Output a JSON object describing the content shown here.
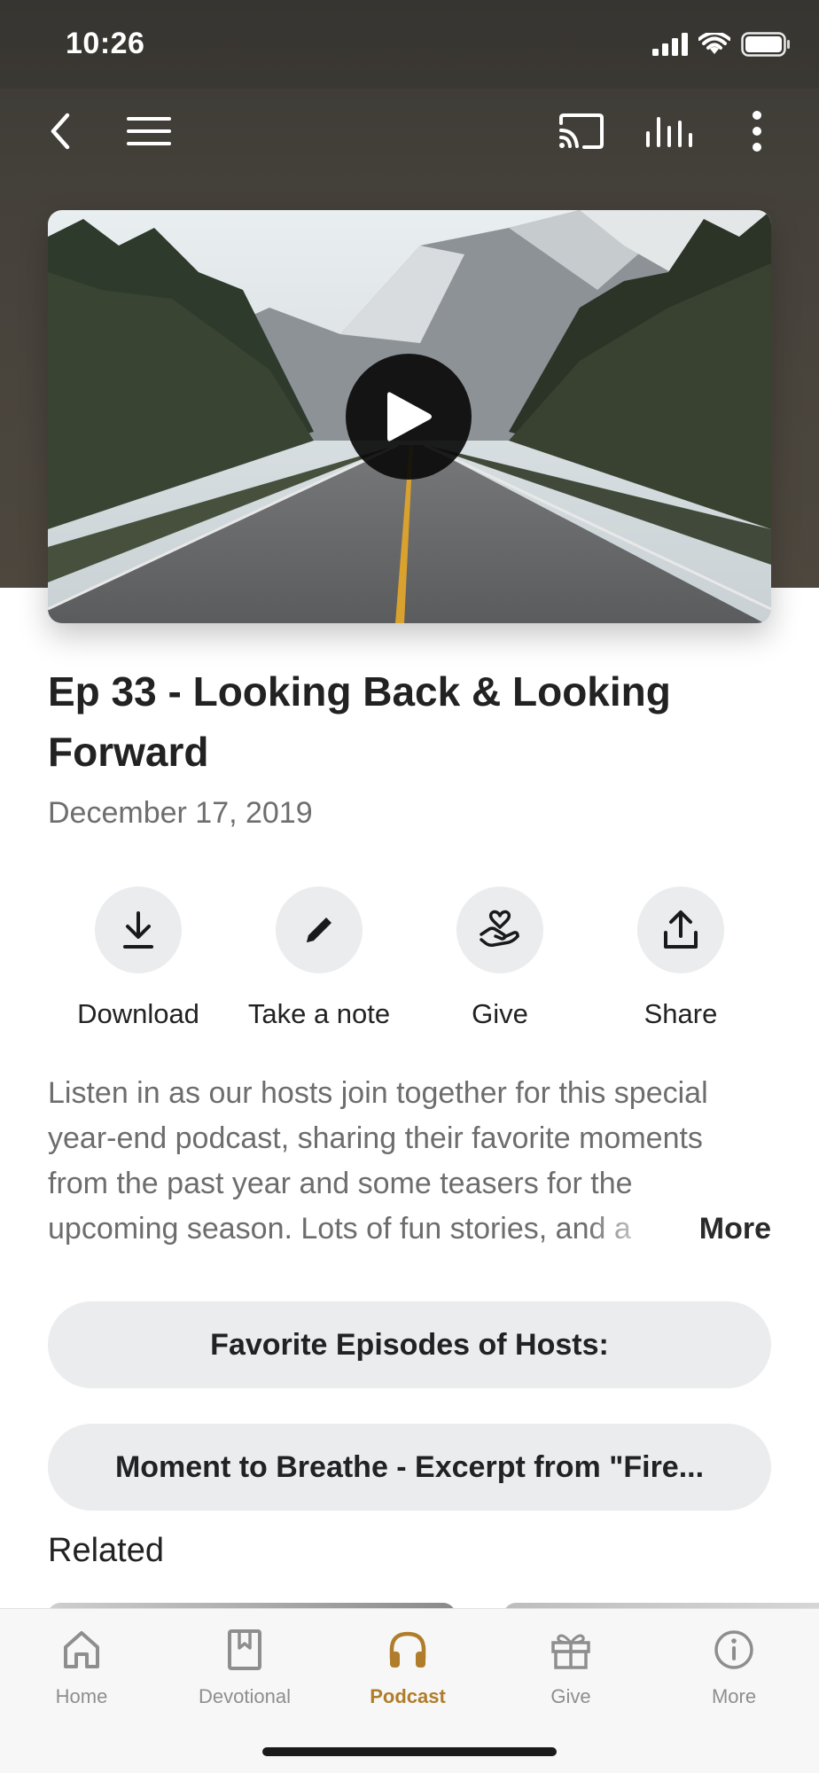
{
  "status_bar": {
    "time": "10:26"
  },
  "toolbar": {
    "back_icon": "chevron-left-icon",
    "menu_icon": "hamburger-icon",
    "cast_icon": "cast-icon",
    "equalizer_icon": "equalizer-icon",
    "overflow_icon": "more-vertical-icon"
  },
  "episode": {
    "title": "Ep 33 - Looking Back & Looking Forward",
    "date": "December 17, 2019",
    "description": "Listen in as our hosts join together for this special year-end podcast, sharing their favorite moments from the past year and some teasers for the upcoming season.  Lots of fun stories, and a",
    "more_label": "More"
  },
  "actions": [
    {
      "label": "Download",
      "icon": "download-icon"
    },
    {
      "label": "Take a note",
      "icon": "pencil-icon"
    },
    {
      "label": "Give",
      "icon": "hand-heart-icon"
    },
    {
      "label": "Share",
      "icon": "share-icon"
    }
  ],
  "pills": [
    {
      "label": "Favorite Episodes of Hosts:"
    },
    {
      "label": "Moment to Breathe - Excerpt from \"Fire..."
    }
  ],
  "related": {
    "title": "Related"
  },
  "tabs": [
    {
      "label": "Home",
      "icon": "home-icon",
      "active": false
    },
    {
      "label": "Devotional",
      "icon": "book-icon",
      "active": false
    },
    {
      "label": "Podcast",
      "icon": "headphones-icon",
      "active": true
    },
    {
      "label": "Give",
      "icon": "gift-icon",
      "active": false
    },
    {
      "label": "More",
      "icon": "info-icon",
      "active": false
    }
  ],
  "colors": {
    "accent": "#b07d2a",
    "header_bg": "#46423b",
    "pill_bg": "#ebecee"
  }
}
